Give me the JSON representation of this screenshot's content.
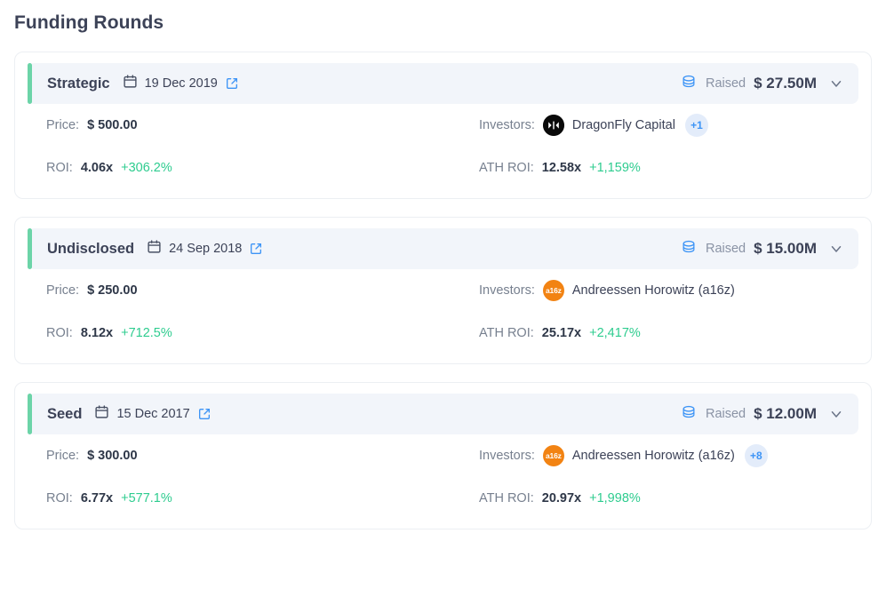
{
  "page": {
    "title": "Funding Rounds"
  },
  "labels": {
    "raised": "Raised",
    "price": "Price:",
    "roi": "ROI:",
    "investors": "Investors:",
    "ath_roi": "ATH ROI:"
  },
  "colors": {
    "accent_green": "#6cd4a8",
    "positive_green": "#2ecc8f",
    "link_blue": "#3d94f6",
    "header_band": "#f2f5fa",
    "text_dark": "#3c4257",
    "text_muted": "#8a93a5",
    "avatar_a16z": "#f28313",
    "avatar_dragonfly": "#0a0a0a",
    "badge_bg": "#e3ecfa"
  },
  "icons": {
    "calendar": "calendar-icon",
    "external_link": "external-link-icon",
    "coins": "coins-stack-icon",
    "chevron_down": "chevron-down-icon"
  },
  "rounds": [
    {
      "name": "Strategic",
      "date": "19 Dec 2019",
      "raised": "$ 27.50M",
      "price": "$ 500.00",
      "roi": "4.06x",
      "roi_change": "+306.2%",
      "investor_name": "DragonFly Capital",
      "investor_avatar": "dragonfly",
      "investor_avatar_text": "",
      "more_investors": "+1",
      "ath_roi": "12.58x",
      "ath_roi_change": "+1,159%"
    },
    {
      "name": "Undisclosed",
      "date": "24 Sep 2018",
      "raised": "$ 15.00M",
      "price": "$ 250.00",
      "roi": "8.12x",
      "roi_change": "+712.5%",
      "investor_name": "Andreessen Horowitz (a16z)",
      "investor_avatar": "a16z",
      "investor_avatar_text": "a16z",
      "more_investors": "",
      "ath_roi": "25.17x",
      "ath_roi_change": "+2,417%"
    },
    {
      "name": "Seed",
      "date": "15 Dec 2017",
      "raised": "$ 12.00M",
      "price": "$ 300.00",
      "roi": "6.77x",
      "roi_change": "+577.1%",
      "investor_name": "Andreessen Horowitz (a16z)",
      "investor_avatar": "a16z",
      "investor_avatar_text": "a16z",
      "more_investors": "+8",
      "ath_roi": "20.97x",
      "ath_roi_change": "+1,998%"
    }
  ]
}
